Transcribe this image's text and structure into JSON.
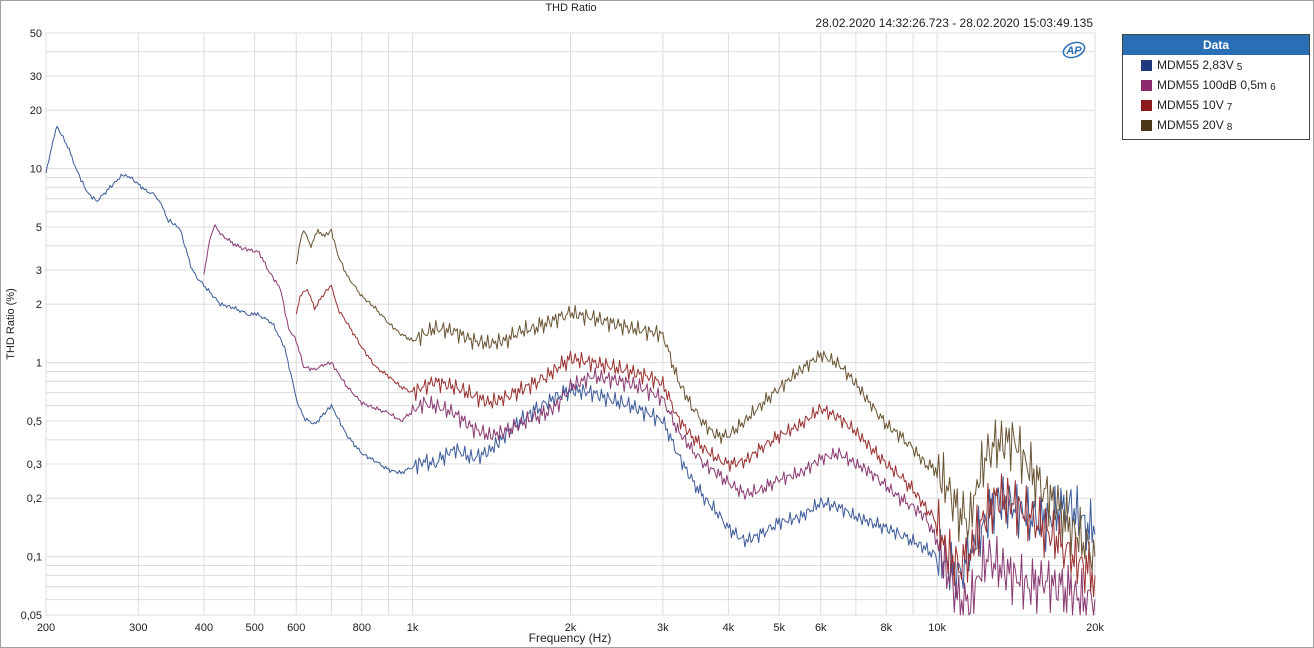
{
  "window": {
    "timestamp": "28.02.2020 14:32:26.723 - 28.02.2020 15:03:49.135",
    "logo_text": "AP"
  },
  "legend": {
    "title": "Data",
    "items": [
      {
        "name": "MDM55 2,83V",
        "index": "5",
        "color": "#1f3a7a"
      },
      {
        "name": "MDM55 100dB 0,5m",
        "index": "6",
        "color": "#8a2a6a"
      },
      {
        "name": "MDM55 10V",
        "index": "7",
        "color": "#8b1a1a"
      },
      {
        "name": "MDM55 20V",
        "index": "8",
        "color": "#4a3a1a"
      }
    ]
  },
  "chart_data": {
    "type": "line",
    "title": "THD Ratio",
    "xlabel": "Frequency (Hz)",
    "ylabel": "THD Ratio (%)",
    "xscale": "log",
    "yscale": "log",
    "xlim": [
      200,
      20000
    ],
    "ylim": [
      0.05,
      50
    ],
    "grid": true,
    "legend_position": "right",
    "x_ticks": [
      {
        "v": 200,
        "label": "200"
      },
      {
        "v": 300,
        "label": "300"
      },
      {
        "v": 400,
        "label": "400"
      },
      {
        "v": 500,
        "label": "500"
      },
      {
        "v": 600,
        "label": "600"
      },
      {
        "v": 800,
        "label": "800"
      },
      {
        "v": 1000,
        "label": "1k"
      },
      {
        "v": 2000,
        "label": "2k"
      },
      {
        "v": 3000,
        "label": "3k"
      },
      {
        "v": 4000,
        "label": "4k"
      },
      {
        "v": 5000,
        "label": "5k"
      },
      {
        "v": 6000,
        "label": "6k"
      },
      {
        "v": 8000,
        "label": "8k"
      },
      {
        "v": 10000,
        "label": "10k"
      },
      {
        "v": 20000,
        "label": "20k"
      }
    ],
    "y_ticks": [
      {
        "v": 50,
        "label": "50"
      },
      {
        "v": 30,
        "label": "30"
      },
      {
        "v": 20,
        "label": "20"
      },
      {
        "v": 10,
        "label": "10"
      },
      {
        "v": 5,
        "label": "5"
      },
      {
        "v": 3,
        "label": "3"
      },
      {
        "v": 2,
        "label": "2"
      },
      {
        "v": 1,
        "label": "1"
      },
      {
        "v": 0.5,
        "label": "0,5"
      },
      {
        "v": 0.3,
        "label": "0,3"
      },
      {
        "v": 0.2,
        "label": "0,2"
      },
      {
        "v": 0.1,
        "label": "0,1"
      },
      {
        "v": 0.05,
        "label": "0,05"
      }
    ],
    "series": [
      {
        "name": "MDM55 2,83V 5",
        "color": "#3d5a99",
        "x": [
          200,
          205,
          210,
          220,
          230,
          240,
          250,
          265,
          280,
          290,
          300,
          310,
          320,
          330,
          340,
          350,
          360,
          370,
          380,
          390,
          400,
          430,
          460,
          490,
          500,
          520,
          540,
          570,
          590,
          600,
          620,
          650,
          680,
          700,
          750,
          800,
          850,
          900,
          950,
          1000,
          1050,
          1100,
          1150,
          1200,
          1300,
          1400,
          1500,
          1600,
          1700,
          1800,
          1900,
          2000,
          2200,
          2400,
          2600,
          2800,
          3000,
          3200,
          3400,
          3600,
          3800,
          4000,
          4300,
          4600,
          5000,
          5500,
          6000,
          6500,
          7000,
          7500,
          8000,
          8500,
          9000,
          9500,
          10000,
          10500,
          11000,
          11500,
          12000,
          12500,
          13000,
          14000,
          15000,
          16000,
          17000,
          18000,
          19000,
          20000
        ],
        "y": [
          9.5,
          13,
          16.5,
          13,
          9.5,
          7.5,
          6.8,
          8,
          9.3,
          9,
          8.3,
          7.7,
          7.4,
          6.8,
          5.5,
          5.2,
          4.9,
          3.8,
          3,
          2.7,
          2.5,
          2,
          1.9,
          1.75,
          1.8,
          1.7,
          1.6,
          1.2,
          0.8,
          0.65,
          0.52,
          0.48,
          0.55,
          0.6,
          0.42,
          0.34,
          0.31,
          0.28,
          0.27,
          0.29,
          0.31,
          0.3,
          0.33,
          0.36,
          0.32,
          0.35,
          0.42,
          0.5,
          0.56,
          0.62,
          0.68,
          0.72,
          0.7,
          0.64,
          0.6,
          0.55,
          0.5,
          0.34,
          0.25,
          0.2,
          0.17,
          0.14,
          0.12,
          0.13,
          0.15,
          0.16,
          0.19,
          0.18,
          0.16,
          0.15,
          0.14,
          0.13,
          0.12,
          0.11,
          0.1,
          0.09,
          0.08,
          0.1,
          0.13,
          0.16,
          0.2,
          0.18,
          0.16,
          0.15,
          0.17,
          0.18,
          0.15,
          0.13
        ]
      },
      {
        "name": "MDM55 100dB 0,5m 6",
        "color": "#8a3a72",
        "x": [
          400,
          410,
          420,
          430,
          450,
          470,
          490,
          510,
          530,
          560,
          580,
          600,
          620,
          650,
          680,
          700,
          750,
          800,
          850,
          900,
          950,
          1000,
          1050,
          1100,
          1200,
          1300,
          1400,
          1500,
          1600,
          1700,
          1800,
          1900,
          2000,
          2200,
          2400,
          2600,
          2800,
          3000,
          3200,
          3400,
          3600,
          3800,
          4000,
          4300,
          4600,
          5000,
          5500,
          6000,
          6500,
          7000,
          7500,
          8000,
          8500,
          9000,
          9500,
          10000,
          10500,
          11000,
          11500,
          12000,
          12500,
          13000,
          14000,
          15000,
          16000,
          17000,
          18000,
          19000,
          20000
        ],
        "y": [
          2.9,
          4.2,
          5.2,
          4.6,
          4.2,
          3.9,
          3.8,
          3.7,
          3.0,
          2.4,
          1.5,
          1.3,
          0.95,
          0.92,
          0.98,
          1.0,
          0.75,
          0.62,
          0.58,
          0.55,
          0.5,
          0.56,
          0.62,
          0.6,
          0.55,
          0.46,
          0.42,
          0.44,
          0.48,
          0.52,
          0.55,
          0.62,
          0.75,
          0.85,
          0.82,
          0.78,
          0.72,
          0.65,
          0.45,
          0.36,
          0.3,
          0.27,
          0.24,
          0.21,
          0.22,
          0.25,
          0.27,
          0.32,
          0.34,
          0.3,
          0.27,
          0.23,
          0.2,
          0.18,
          0.16,
          0.12,
          0.08,
          0.06,
          0.055,
          0.08,
          0.1,
          0.09,
          0.08,
          0.07,
          0.075,
          0.07,
          0.065,
          0.06,
          0.06
        ]
      },
      {
        "name": "MDM55 10V 7",
        "color": "#9a3030",
        "x": [
          600,
          610,
          630,
          650,
          680,
          700,
          720,
          750,
          800,
          850,
          900,
          950,
          1000,
          1050,
          1100,
          1200,
          1300,
          1400,
          1500,
          1600,
          1700,
          1800,
          1900,
          2000,
          2200,
          2400,
          2600,
          2800,
          3000,
          3200,
          3400,
          3600,
          3800,
          4000,
          4300,
          4600,
          5000,
          5500,
          6000,
          6500,
          7000,
          7500,
          8000,
          8500,
          9000,
          9500,
          10000,
          10500,
          11000,
          11500,
          12000,
          12500,
          13000,
          14000,
          15000,
          16000,
          17000,
          18000,
          19000,
          20000
        ],
        "y": [
          1.8,
          2.2,
          2.4,
          1.9,
          2.3,
          2.5,
          1.9,
          1.6,
          1.2,
          0.95,
          0.85,
          0.75,
          0.7,
          0.75,
          0.8,
          0.75,
          0.68,
          0.62,
          0.66,
          0.72,
          0.78,
          0.85,
          0.95,
          1.05,
          1.0,
          0.95,
          0.9,
          0.85,
          0.78,
          0.52,
          0.42,
          0.36,
          0.32,
          0.3,
          0.31,
          0.36,
          0.42,
          0.48,
          0.58,
          0.52,
          0.44,
          0.36,
          0.3,
          0.26,
          0.22,
          0.18,
          0.15,
          0.1,
          0.09,
          0.1,
          0.14,
          0.17,
          0.2,
          0.19,
          0.16,
          0.14,
          0.12,
          0.1,
          0.09,
          0.08
        ]
      },
      {
        "name": "MDM55 20V 8",
        "color": "#6a5535",
        "x": [
          600,
          610,
          620,
          640,
          660,
          680,
          700,
          720,
          750,
          800,
          850,
          900,
          950,
          1000,
          1050,
          1100,
          1200,
          1300,
          1400,
          1500,
          1600,
          1700,
          1800,
          1900,
          2000,
          2200,
          2400,
          2600,
          2800,
          3000,
          3200,
          3400,
          3600,
          3800,
          4000,
          4300,
          4600,
          5000,
          5500,
          6000,
          6500,
          7000,
          7500,
          8000,
          8500,
          9000,
          9500,
          10000,
          10500,
          11000,
          11500,
          12000,
          12500,
          13000,
          14000,
          15000,
          16000,
          17000,
          18000,
          19000,
          20000
        ],
        "y": [
          3.2,
          4.2,
          4.8,
          4.0,
          4.8,
          4.5,
          4.8,
          3.6,
          2.8,
          2.2,
          1.9,
          1.6,
          1.4,
          1.3,
          1.4,
          1.5,
          1.45,
          1.3,
          1.25,
          1.3,
          1.45,
          1.5,
          1.6,
          1.7,
          1.8,
          1.7,
          1.6,
          1.5,
          1.45,
          1.4,
          0.82,
          0.6,
          0.48,
          0.42,
          0.42,
          0.5,
          0.6,
          0.74,
          0.92,
          1.1,
          0.98,
          0.78,
          0.6,
          0.48,
          0.42,
          0.36,
          0.3,
          0.28,
          0.22,
          0.17,
          0.15,
          0.25,
          0.35,
          0.38,
          0.4,
          0.28,
          0.22,
          0.18,
          0.14,
          0.12,
          0.1
        ]
      }
    ]
  }
}
